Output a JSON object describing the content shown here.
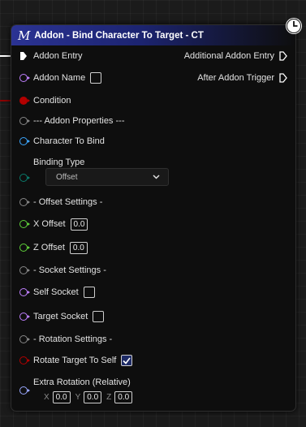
{
  "node": {
    "macro_symbol": "M",
    "title": "Addon - Bind Character To Target - CT"
  },
  "inputs": {
    "addon_entry": "Addon Entry",
    "addon_name": "Addon Name",
    "condition": "Condition",
    "addon_properties": "--- Addon Properties ---",
    "character_to_bind": "Character To Bind",
    "binding_type": "Binding Type",
    "binding_type_value": "Offset",
    "offset_settings": "- Offset Settings -",
    "x_offset": "X Offset",
    "x_offset_value": "0.0",
    "z_offset": "Z Offset",
    "z_offset_value": "0.0",
    "socket_settings": "- Socket Settings -",
    "self_socket": "Self Socket",
    "target_socket": "Target Socket",
    "rotation_settings": "- Rotation Settings -",
    "rotate_target_to_self": "Rotate Target To Self",
    "rotate_target_to_self_checked": true,
    "extra_rotation": "Extra Rotation (Relative)",
    "extra_rotation_x_label": "X",
    "extra_rotation_x": "0.0",
    "extra_rotation_y_label": "Y",
    "extra_rotation_y": "0.0",
    "extra_rotation_z_label": "Z",
    "extra_rotation_z": "0.0"
  },
  "outputs": {
    "additional_addon_entry": "Additional Addon Entry",
    "after_addon_trigger": "After Addon Trigger"
  },
  "colors": {
    "header": "#2b3393",
    "exec": "#ffffff",
    "name_pin": "#c080ff",
    "bool_pin": "#b30000",
    "wildcard_pin": "#888888",
    "object_pin": "#3ca7ff",
    "enum_pin": "#0a7a6b",
    "float_pin": "#5fd03a",
    "struct_pin": "#9aa8ff"
  }
}
